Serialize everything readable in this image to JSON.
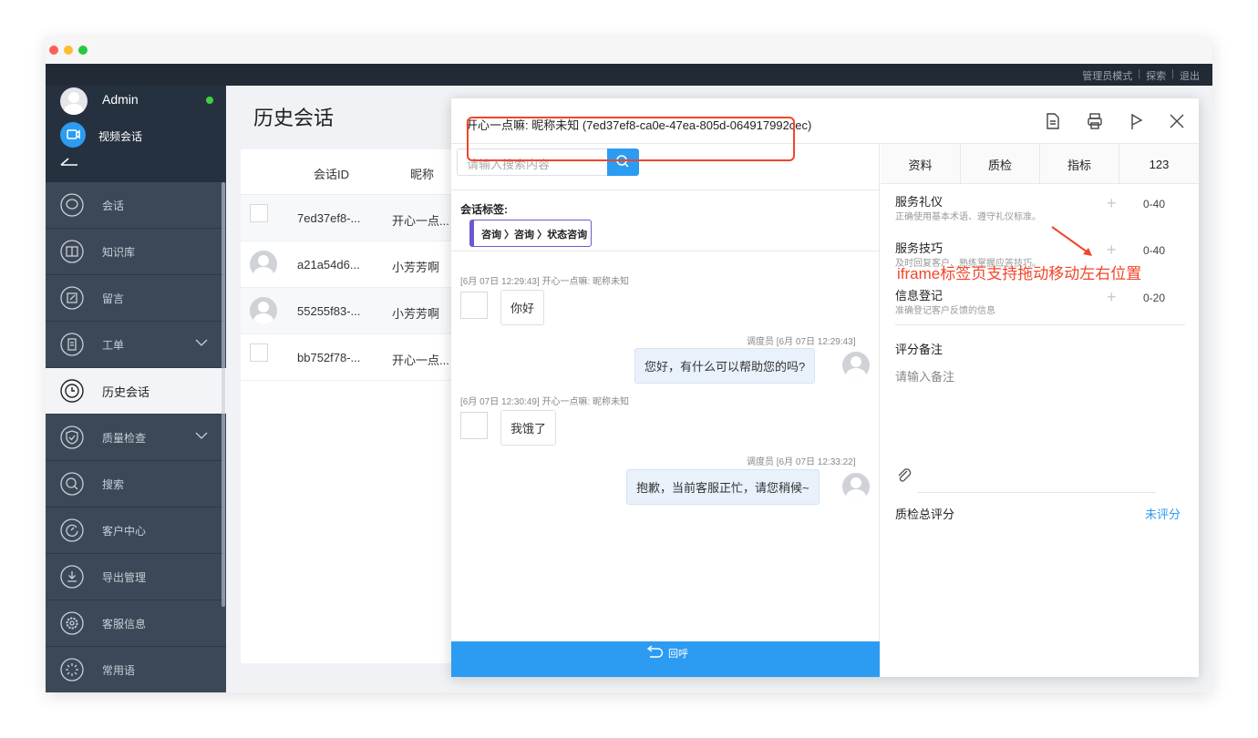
{
  "topnav": {
    "admin_mode": "管理员模式",
    "explore": "探索",
    "logout": "退出",
    "sep": "|"
  },
  "sidebar": {
    "user_name": "Admin",
    "video_label": "视频会话",
    "items": [
      {
        "label": "会话",
        "icon": "chat-bubble-icon"
      },
      {
        "label": "知识库",
        "icon": "book-icon"
      },
      {
        "label": "留言",
        "icon": "edit-note-icon"
      },
      {
        "label": "工单",
        "icon": "document-icon",
        "expandable": true
      },
      {
        "label": "历史会话",
        "icon": "clock-icon",
        "active": true
      },
      {
        "label": "质量检查",
        "icon": "shield-check-icon",
        "expandable": true
      },
      {
        "label": "搜索",
        "icon": "search-icon"
      },
      {
        "label": "客户中心",
        "icon": "customer-icon"
      },
      {
        "label": "导出管理",
        "icon": "export-icon"
      },
      {
        "label": "客服信息",
        "icon": "settings-icon"
      },
      {
        "label": "常用语",
        "icon": "phrases-icon"
      }
    ]
  },
  "main": {
    "title": "历史会话",
    "columns": {
      "id": "会话ID",
      "nick": "昵称"
    },
    "rows": [
      {
        "id": "7ed37ef8-...",
        "nick": "开心一点...",
        "avatar": "image"
      },
      {
        "id": "a21a54d6...",
        "nick": "小芳芳啊",
        "avatar": "person"
      },
      {
        "id": "55255f83-...",
        "nick": "小芳芳啊",
        "avatar": "person"
      },
      {
        "id": "bb752f78-...",
        "nick": "开心一点...",
        "avatar": "image"
      }
    ]
  },
  "modal": {
    "title": "开心一点嘛: 昵称未知 (7ed37ef8-ca0e-47ea-805d-064917992cec)",
    "search_placeholder": "请输入搜索内容",
    "tag_label": "会话标签:",
    "tag_value": "咨询 〉咨询 〉状态咨询",
    "messages": [
      {
        "meta": "[6月 07日 12:29:43] 开心一点嘛: 昵称未知",
        "text": "你好"
      },
      {
        "meta": "调度员 [6月 07日 12:29:43]",
        "text": "您好，有什么可以帮助您的吗?"
      },
      {
        "meta": "[6月 07日 12:30:49] 开心一点嘛: 昵称未知",
        "text": "我饿了"
      },
      {
        "meta": "调度员 [6月 07日 12:33:22]",
        "text": "抱歉，当前客服正忙，请您稍候~"
      }
    ],
    "callback_label": "回呼",
    "tabs": [
      "资料",
      "质检",
      "指标",
      "123"
    ],
    "qc_items": [
      {
        "title": "服务礼仪",
        "desc": "正确使用基本术语、遵守礼仪标准。",
        "plus": "+",
        "range": "0-40"
      },
      {
        "title": "服务技巧",
        "desc": "及时回复客户、熟练掌握应答技巧。",
        "plus": "+",
        "range": "0-40"
      },
      {
        "title": "信息登记",
        "desc": "准确登记客户反馈的信息",
        "plus": "+",
        "range": "0-20"
      }
    ],
    "note_title": "评分备注",
    "note_placeholder": "请输入备注",
    "total_label": "质检总评分",
    "total_value": "未评分"
  },
  "annotation": "iframe标签页支持拖动移动左右位置",
  "colors": {
    "accent": "#2b9cf2",
    "highlight": "#f2452a",
    "sidebar": "#3c4857"
  }
}
